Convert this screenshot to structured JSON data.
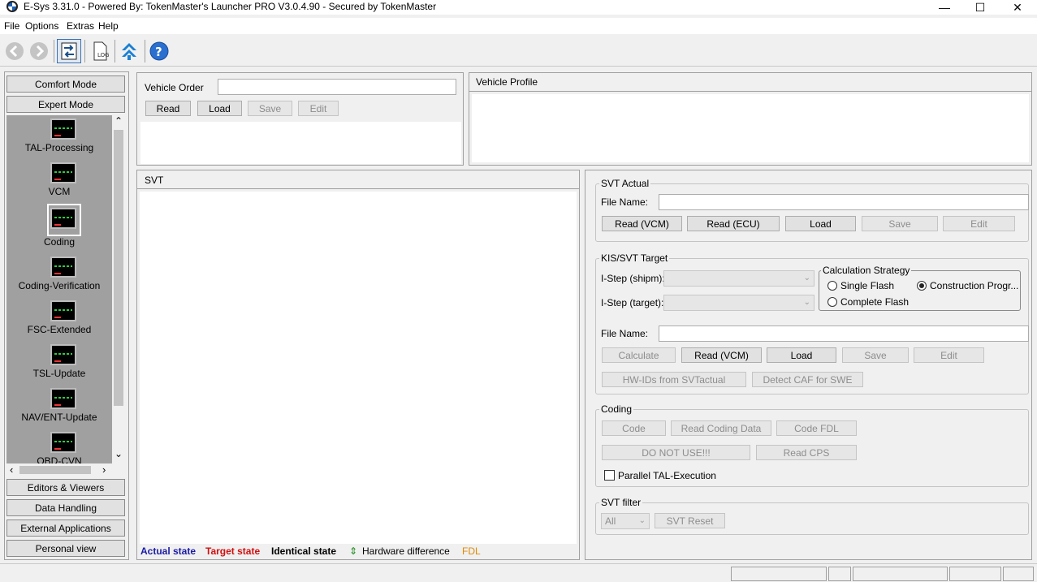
{
  "window": {
    "title": "E-Sys 3.31.0 - Powered By: TokenMaster's Launcher PRO V3.0.4.90 - Secured by TokenMaster",
    "minimize": "—",
    "maximize": "☐",
    "close": "✕"
  },
  "menu": [
    "File",
    "Options",
    "Extras",
    "Help"
  ],
  "toolbar": {
    "icons": [
      "back-arrow-icon",
      "forward-arrow-icon",
      "connect-icon",
      "log-icon",
      "update-icon",
      "help-icon"
    ],
    "log_text": "LOG",
    "help_text": "?"
  },
  "nav": {
    "comfort": "Comfort Mode",
    "expert": "Expert Mode",
    "items": [
      "TAL-Processing",
      "VCM",
      "Coding",
      "Coding-Verification",
      "FSC-Extended",
      "TSL-Update",
      "NAV/ENT-Update",
      "OBD-CVN"
    ],
    "selected": "Coding",
    "bottom": [
      "Editors & Viewers",
      "Data Handling",
      "External Applications",
      "Personal view"
    ],
    "scroll_up": "⌃",
    "scroll_down": "⌄",
    "scroll_left": "‹",
    "scroll_right": "›"
  },
  "vehicle_order": {
    "label": "Vehicle Order",
    "value": "",
    "read": "Read",
    "load": "Load",
    "save": "Save",
    "edit": "Edit"
  },
  "vehicle_profile": {
    "title": "Vehicle Profile"
  },
  "svt": {
    "title": "SVT"
  },
  "legend": {
    "actual": "Actual state",
    "target": "Target state",
    "identical": "Identical state",
    "hw_icon": "⇕",
    "hw": "Hardware difference",
    "fdl": "FDL",
    "colors": {
      "actual": "#1a1aa6",
      "target": "#d01010",
      "identical": "#000000",
      "hw": "#1a8a1a",
      "fdl": "#e08a00"
    }
  },
  "svt_actual": {
    "title": "SVT Actual",
    "file_label": "File Name:",
    "file_value": "",
    "read_vcm": "Read (VCM)",
    "read_ecu": "Read (ECU)",
    "load": "Load",
    "save": "Save",
    "edit": "Edit"
  },
  "kis": {
    "title": "KIS/SVT Target",
    "istep_shipm": "I-Step (shipm):",
    "istep_target": "I-Step (target):",
    "strategy_title": "Calculation Strategy",
    "single": "Single Flash",
    "construction": "Construction Progr...",
    "complete": "Complete Flash",
    "selected_strategy": "construction",
    "file_label": "File Name:",
    "file_value": "",
    "calculate": "Calculate",
    "read_vcm": "Read (VCM)",
    "load": "Load",
    "save": "Save",
    "edit": "Edit",
    "hwids": "HW-IDs from SVTactual",
    "detect_caf": "Detect CAF for SWE"
  },
  "coding": {
    "title": "Coding",
    "code": "Code",
    "read_coding": "Read Coding Data",
    "code_fdl": "Code FDL",
    "do_not_use": "DO NOT USE!!!",
    "read_cps": "Read CPS",
    "parallel": "Parallel TAL-Execution",
    "parallel_checked": false
  },
  "svt_filter": {
    "title": "SVT filter",
    "selected": "All",
    "reset": "SVT Reset"
  }
}
